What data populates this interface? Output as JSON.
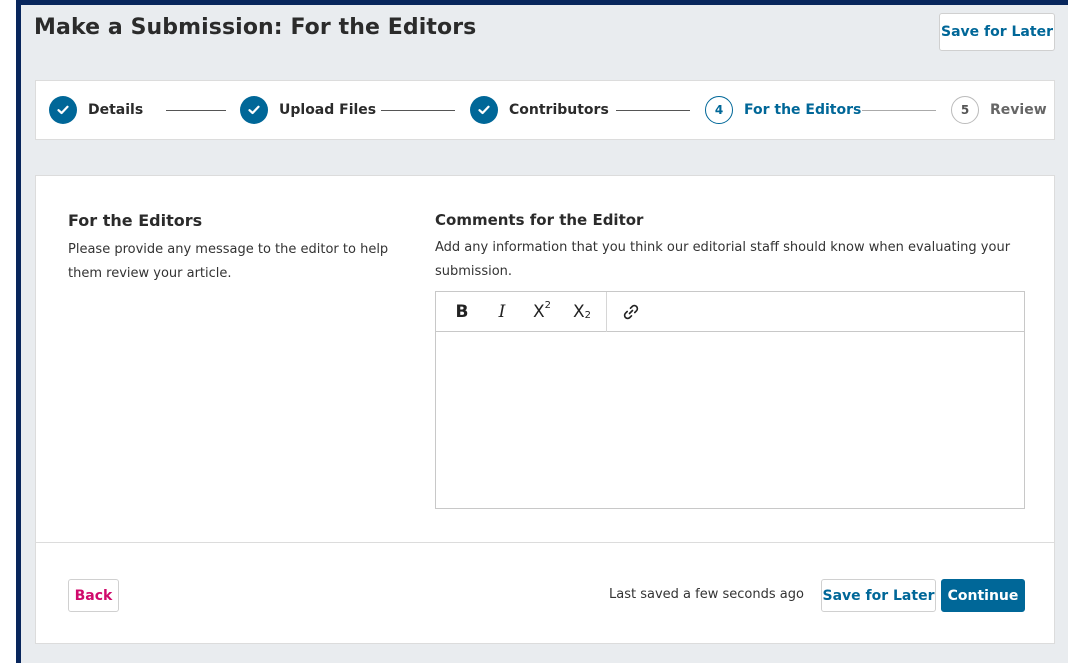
{
  "header": {
    "title": "Make a Submission: For the Editors",
    "save_label": "Save for Later"
  },
  "steps": [
    {
      "number": "1",
      "label": "Details",
      "status": "complete",
      "icon": "check-icon"
    },
    {
      "number": "2",
      "label": "Upload Files",
      "status": "complete",
      "icon": "check-icon"
    },
    {
      "number": "3",
      "label": "Contributors",
      "status": "complete",
      "icon": "check-icon"
    },
    {
      "number": "4",
      "label": "For the Editors",
      "status": "current"
    },
    {
      "number": "5",
      "label": "Review",
      "status": "upcoming"
    }
  ],
  "section": {
    "title": "For the Editors",
    "description": "Please provide any message to the editor to help them review your article."
  },
  "comments": {
    "title": "Comments for the Editor",
    "description": "Add any information that you think our editorial staff should know when evaluating your submission.",
    "value": "",
    "toolbar": [
      {
        "name": "bold-button",
        "glyph": "B",
        "icon": "bold-icon"
      },
      {
        "name": "italic-button",
        "glyph": "I",
        "icon": "italic-icon"
      },
      {
        "name": "superscript-button",
        "glyph": "X²",
        "icon": "superscript-icon"
      },
      {
        "name": "subscript-button",
        "glyph": "X₂",
        "icon": "subscript-icon"
      },
      {
        "name": "link-button",
        "glyph": "link",
        "icon": "link-icon"
      }
    ]
  },
  "footer": {
    "back_label": "Back",
    "status_text": "Last saved a few seconds ago",
    "save_label": "Save for Later",
    "continue_label": "Continue"
  },
  "colors": {
    "primary": "#006798",
    "back_link": "#d00a6c",
    "frame_accent": "#08265c",
    "page_background": "#e9ecef"
  }
}
